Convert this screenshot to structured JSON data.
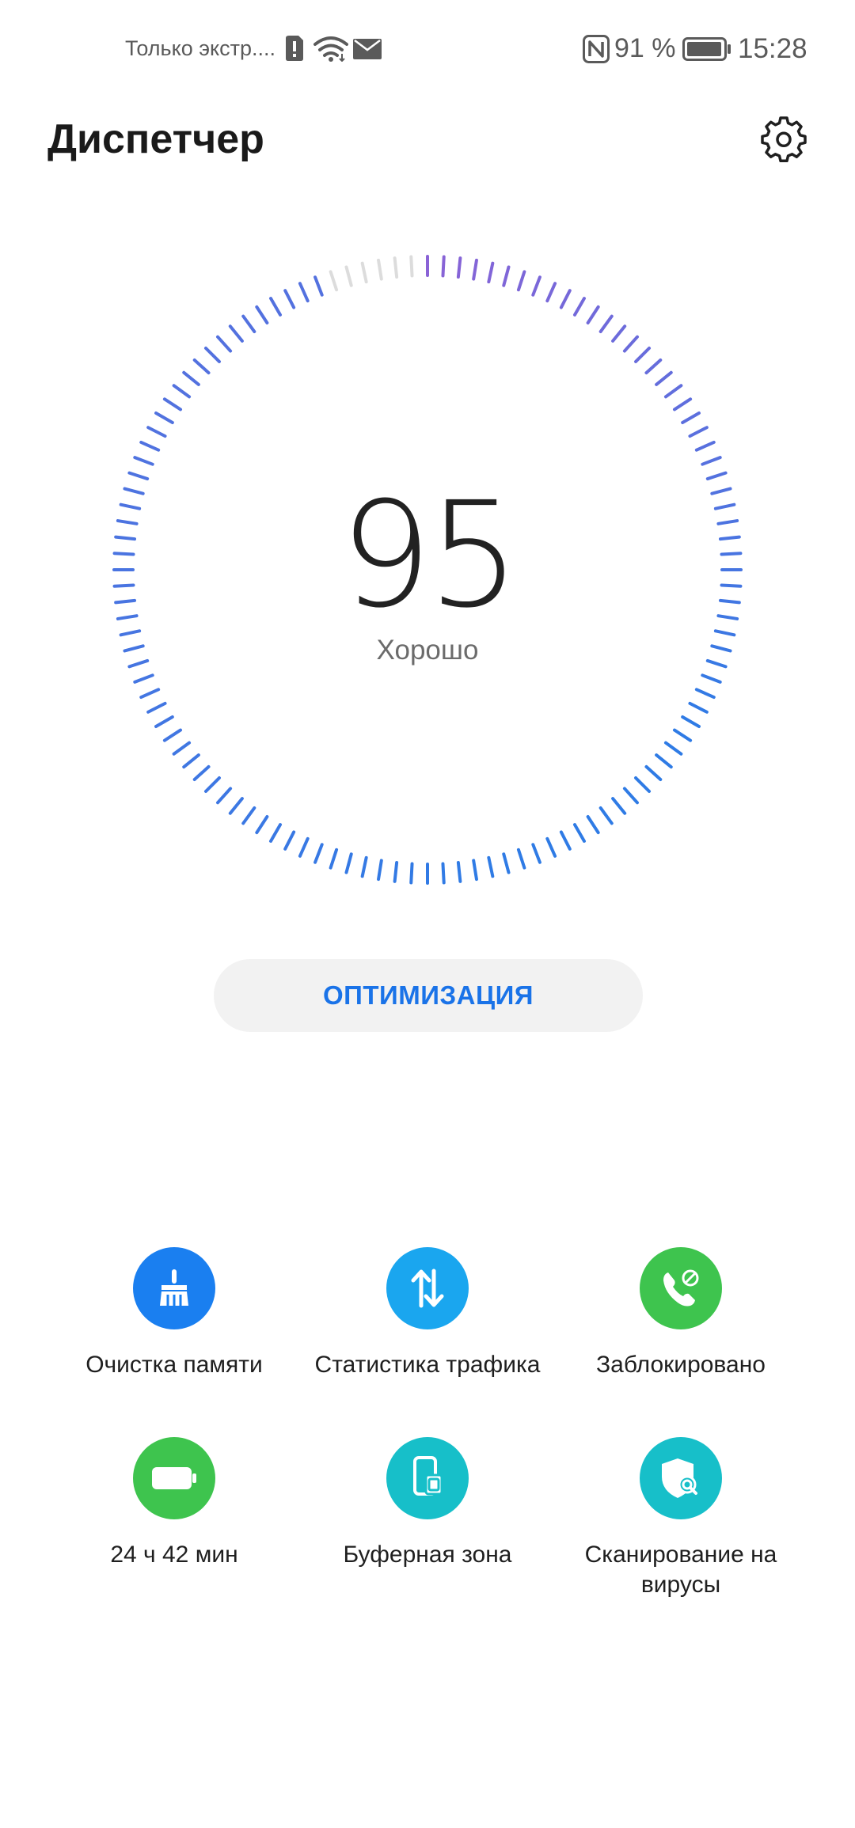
{
  "status_bar": {
    "carrier_text": "Только экстр....",
    "battery_percent": "91 %",
    "time": "15:28",
    "icons": [
      "sim-alert-icon",
      "wifi-icon",
      "mail-icon",
      "nfc-icon",
      "battery-icon"
    ]
  },
  "header": {
    "title": "Диспетчер",
    "settings_icon": "gear-icon"
  },
  "score": {
    "value": "95",
    "label": "Хорошо",
    "fraction": 0.95
  },
  "optimize_label": "ОПТИМИЗАЦИЯ",
  "tools": [
    {
      "label": "Очистка памяти",
      "icon": "broom-icon",
      "color": "#1a7ff0"
    },
    {
      "label": "Статистика трафика",
      "icon": "traffic-arrows-icon",
      "color": "#1aa6ef"
    },
    {
      "label": "Заблокировано",
      "icon": "blocked-call-icon",
      "color": "#3ec44e"
    },
    {
      "label": "24 ч 42 мин",
      "icon": "battery-icon",
      "color": "#3ec44e"
    },
    {
      "label": "Буферная зона",
      "icon": "phone-buffer-icon",
      "color": "#17bfc9"
    },
    {
      "label": "Сканирование на вирусы",
      "icon": "shield-scan-icon",
      "color": "#17bfc9"
    }
  ],
  "colors": {
    "accent": "#1a73e8",
    "dial_start": "#8a63d6",
    "dial_end": "#2f7be5",
    "dial_inactive": "#dcdcdc"
  }
}
